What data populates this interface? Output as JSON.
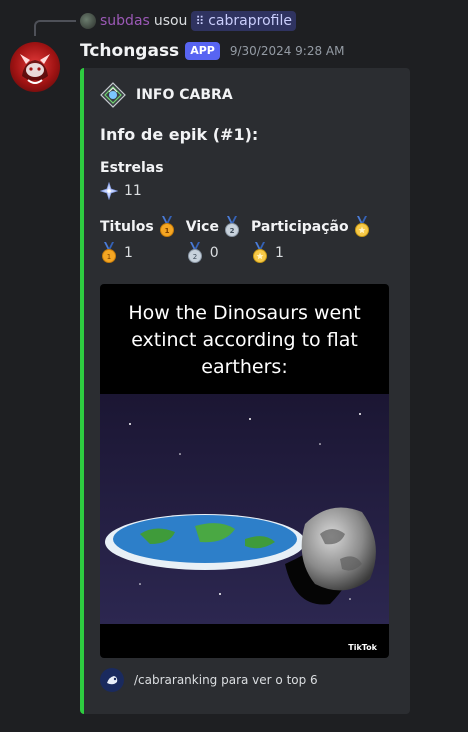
{
  "reply": {
    "username": "subdas",
    "verb": "usou",
    "command": "cabraprofile"
  },
  "message": {
    "author": "Tchongass",
    "badge": "APP",
    "timestamp": "9/30/2024 9:28 AM"
  },
  "embed": {
    "accent_color": "#2ecc40",
    "author_name": "INFO CABRA",
    "title": "Info de epik (#1):",
    "fields": {
      "estrelas": {
        "name": "Estrelas",
        "value": "11"
      },
      "titulos": {
        "name": "Titulos",
        "value": "1"
      },
      "vice": {
        "name": "Vice",
        "value": "0"
      },
      "participacao": {
        "name": "Participação",
        "value": "1"
      }
    },
    "image": {
      "caption": "How the Dinosaurs went extinct according to flat earthers:",
      "watermark": "TikTok"
    },
    "footer": "/cabraranking para ver o top 6"
  }
}
